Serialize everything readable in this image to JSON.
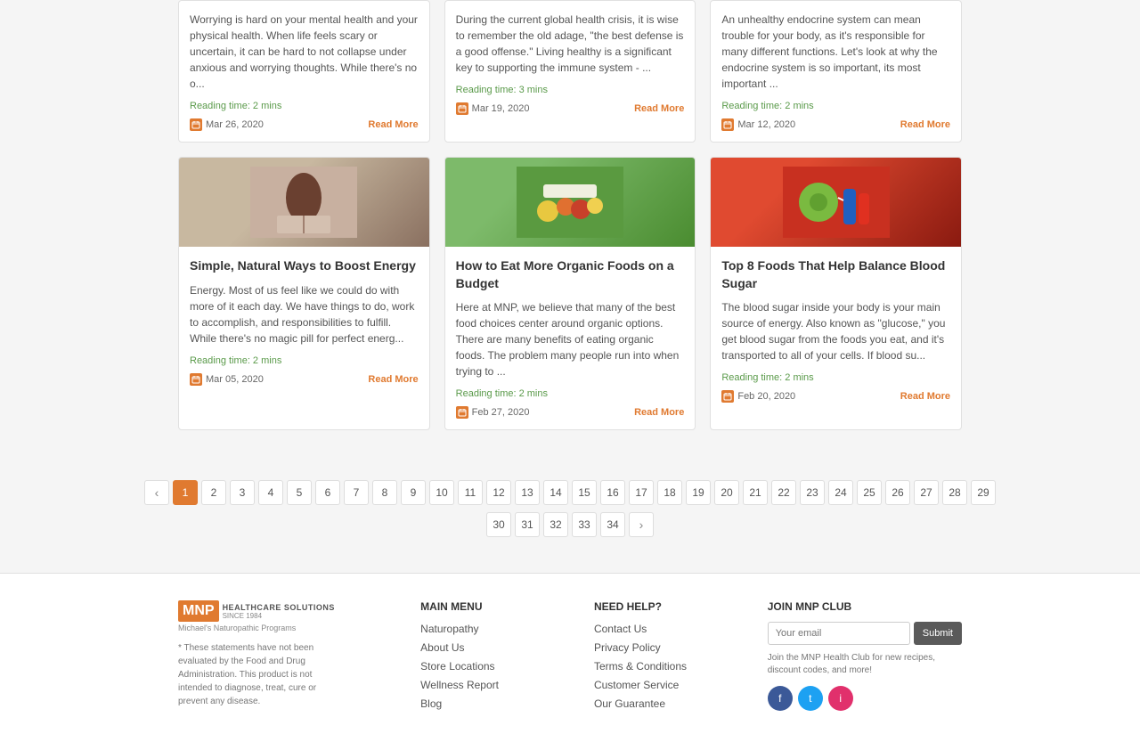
{
  "cards_row1": [
    {
      "excerpt": "Worrying is hard on your mental health and your physical health. When life feels scary or uncertain, it can be hard to not collapse under anxious and worrying thoughts. While there's no o...",
      "reading_time": "Reading time: 2 mins",
      "date": "Mar 26, 2020",
      "read_more": "Read More"
    },
    {
      "excerpt": "During the current global health crisis, it is wise to remember the old adage, \"the best defense is a good offense.\" Living healthy is a significant key to supporting the immune system - ...",
      "reading_time": "Reading time: 3 mins",
      "date": "Mar 19, 2020",
      "read_more": "Read More"
    },
    {
      "excerpt": "An unhealthy endocrine system can mean trouble for your body, as it's responsible for many different functions. Let's look at why the endocrine system is so important, its most important ...",
      "reading_time": "Reading time: 2 mins",
      "date": "Mar 12, 2020",
      "read_more": "Read More"
    }
  ],
  "cards_row2": [
    {
      "title": "Simple, Natural Ways to Boost Energy",
      "excerpt": "Energy. Most of us feel like we could do with more of it each day. We have things to do, work to accomplish, and responsibilities to fulfill. While there's no magic pill for perfect energ...",
      "reading_time": "Reading time: 2 mins",
      "date": "Mar 05, 2020",
      "read_more": "Read More",
      "image_type": "energy"
    },
    {
      "title": "How to Eat More Organic Foods on a Budget",
      "excerpt": "Here at MNP, we believe that many of the best food choices center around organic options. There are many benefits of eating organic foods. The problem many people run into when trying to ...",
      "reading_time": "Reading time: 2 mins",
      "date": "Feb 27, 2020",
      "read_more": "Read More",
      "image_type": "organic"
    },
    {
      "title": "Top 8 Foods That Help Balance Blood Sugar",
      "excerpt": "The blood sugar inside your body is your main source of energy. Also known as \"glucose,\" you get blood sugar from the foods you eat, and it's transported to all of your cells. If blood su...",
      "reading_time": "Reading time: 2 mins",
      "date": "Feb 20, 2020",
      "read_more": "Read More",
      "image_type": "blood-sugar"
    }
  ],
  "pagination": {
    "prev_label": "‹",
    "next_label": "›",
    "pages_row1": [
      "1",
      "2",
      "3",
      "4",
      "5",
      "6",
      "7",
      "8",
      "9",
      "10",
      "11",
      "12",
      "13",
      "14",
      "15",
      "16",
      "17",
      "18",
      "19",
      "20",
      "21",
      "22",
      "23",
      "24",
      "25",
      "26",
      "27",
      "28",
      "29"
    ],
    "pages_row2": [
      "30",
      "31",
      "32",
      "33",
      "34"
    ],
    "active_page": "1"
  },
  "footer": {
    "logo_mnp": "MNP",
    "logo_brand": "HEALTHCARE SOLUTIONS",
    "logo_since": "SINCE 1984",
    "logo_subtitle": "Michael's Naturopathic Programs",
    "disclaimer": "* These statements have not been evaluated by the Food and Drug Administration. This product is not intended to diagnose, treat, cure or prevent any disease.",
    "main_menu_title": "MAIN MENU",
    "main_menu_items": [
      "Naturopathy",
      "About Us",
      "Store Locations",
      "Wellness Report",
      "Blog"
    ],
    "need_help_title": "NEED HELP?",
    "need_help_items": [
      "Contact Us",
      "Privacy Policy",
      "Terms & Conditions",
      "Customer Service",
      "Our Guarantee"
    ],
    "join_title": "Join MNP Club",
    "email_placeholder": "Your email",
    "submit_label": "Submit",
    "join_text": "Join the MNP Health Club for new recipes, discount codes, and more!"
  }
}
